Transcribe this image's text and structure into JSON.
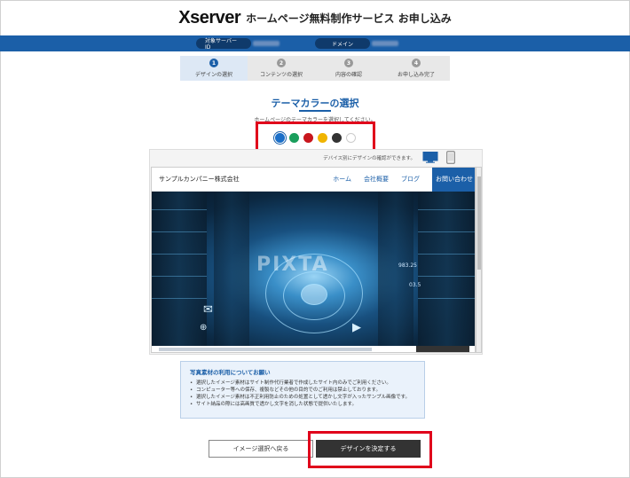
{
  "header": {
    "logo": "Xserver",
    "title": "ホームページ無料制作サービス お申し込み"
  },
  "info_bar": {
    "server_label": "対象サーバーID",
    "domain_label": "ドメイン"
  },
  "steps": [
    {
      "num": "1",
      "label": "デザインの選択",
      "active": true
    },
    {
      "num": "2",
      "label": "コンテンツの選択",
      "active": false
    },
    {
      "num": "3",
      "label": "内容の確認",
      "active": false
    },
    {
      "num": "4",
      "label": "お申し込み完了",
      "active": false
    }
  ],
  "theme": {
    "title": "テーマカラーの選択",
    "subtitle": "ホームページのテーマカラーを選択してください。",
    "colors": [
      "#1b6fc8",
      "#1a9e5c",
      "#c8161d",
      "#f0b400",
      "#333333",
      "#ffffff"
    ],
    "selected_index": 0
  },
  "preview": {
    "device_hint": "デバイス別にデザインの確認ができます。",
    "site_name": "サンプルカンパニー株式会社",
    "nav_home": "ホーム",
    "nav_about": "会社概要",
    "nav_blog": "ブログ",
    "nav_contact": "お問い合わせ",
    "watermark": "PIXTA"
  },
  "notice": {
    "title": "写真素材の利用についてお願い",
    "items": [
      "選択したイメージ素材はサイト制作代行業者で作成したサイト内のみでご利用ください。",
      "コンピューター等への保存、複製などその他の目的でのご利用は禁止しております。",
      "選択したイメージ素材は不正利用防止のための処置として透かし文字が入ったサンプル画像です。",
      "サイト納品の際には高画質で透かし文字を消した状態で提供いたします。"
    ]
  },
  "buttons": {
    "back": "イメージ選択へ戻る",
    "decide": "デザインを決定する"
  }
}
